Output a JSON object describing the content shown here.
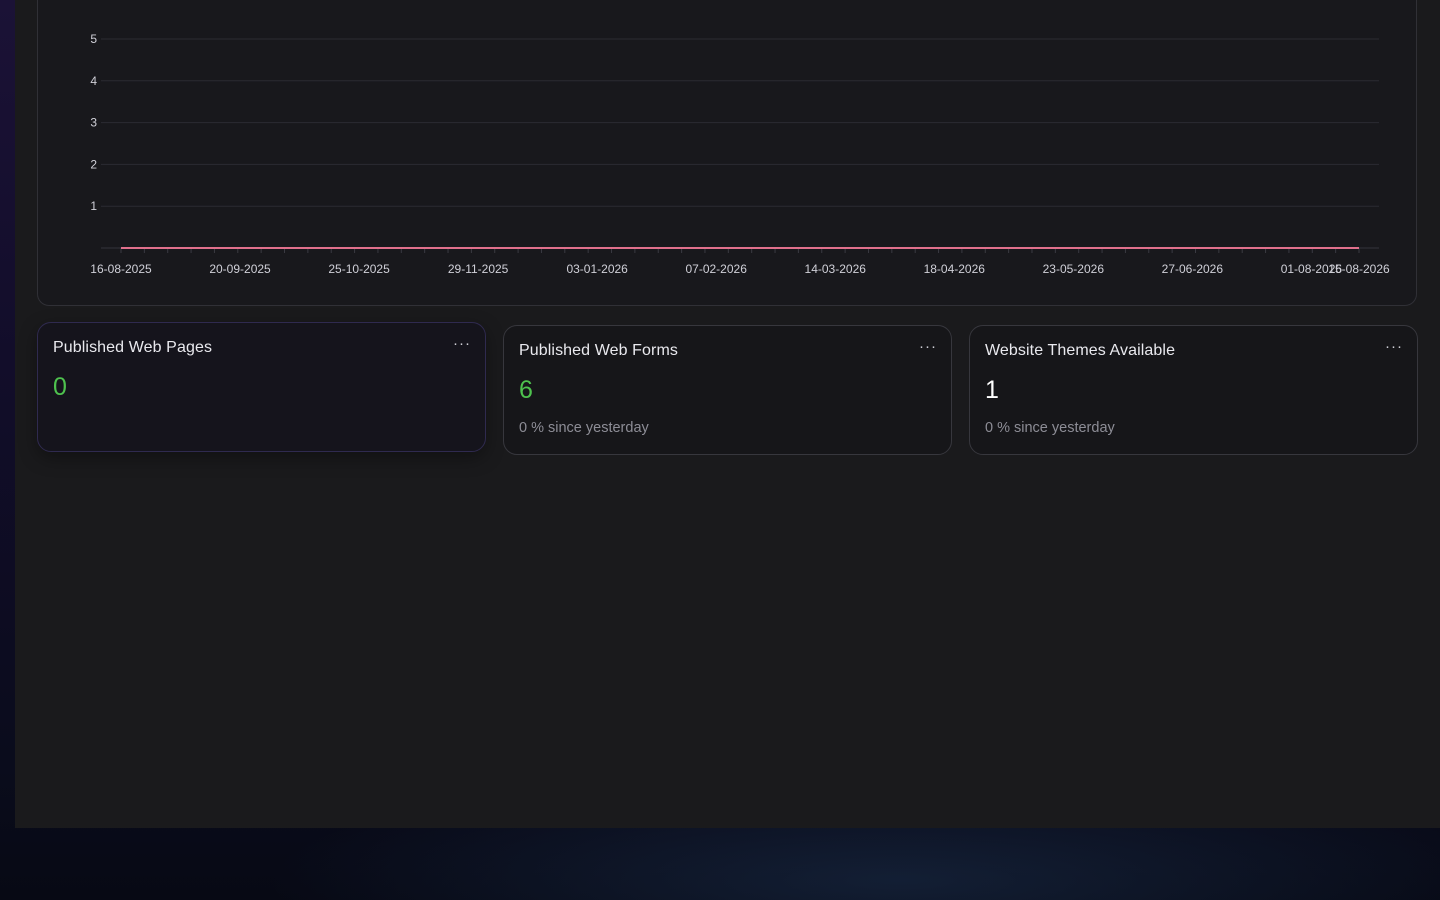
{
  "colors": {
    "positive": "#4ec24e",
    "neutral": "#ffffff",
    "series_line": "#e0708c"
  },
  "chart_data": {
    "type": "line",
    "title": "",
    "xlabel": "",
    "ylabel": "",
    "ylim": [
      0,
      5
    ],
    "y_ticks": [
      "1",
      "2",
      "3",
      "4",
      "5"
    ],
    "x_tick_labels": [
      "16-08-2025",
      "20-09-2025",
      "25-10-2025",
      "29-11-2025",
      "03-01-2026",
      "07-02-2026",
      "14-03-2026",
      "18-04-2026",
      "23-05-2026",
      "27-06-2026",
      "01-08-2026",
      "15-08-2026"
    ],
    "x_range": [
      "16-08-2025",
      "15-08-2026"
    ],
    "series": [
      {
        "color": "#e0708c",
        "points": [
          [
            "16-08-2025",
            0
          ],
          [
            "15-08-2026",
            0
          ]
        ]
      }
    ],
    "grid": true
  },
  "cards": [
    {
      "title": "Published Web Pages",
      "menu": "···",
      "value": "0",
      "value_color": "positive",
      "subtitle": ""
    },
    {
      "title": "Published Web Forms",
      "menu": "···",
      "value": "6",
      "value_color": "positive",
      "subtitle": "0 % since yesterday"
    },
    {
      "title": "Website Themes Available",
      "menu": "···",
      "value": "1",
      "value_color": "neutral",
      "subtitle": "0 % since yesterday"
    }
  ]
}
